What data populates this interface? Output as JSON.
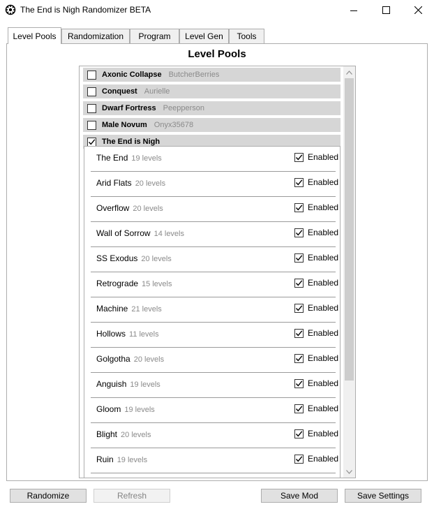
{
  "window": {
    "title": "The End is Nigh Randomizer BETA",
    "icon": "cog-wheel-icon"
  },
  "tabs": [
    {
      "label": "Level Pools",
      "active": true
    },
    {
      "label": "Randomization",
      "active": false
    },
    {
      "label": "Program",
      "active": false
    },
    {
      "label": "Level Gen",
      "active": false
    },
    {
      "label": "Tools",
      "active": false
    }
  ],
  "panel": {
    "heading": "Level Pools"
  },
  "pools": [
    {
      "name": "Axonic Collapse",
      "author": "ButcherBerries",
      "checked": false
    },
    {
      "name": "Conquest",
      "author": "Aurielle",
      "checked": false
    },
    {
      "name": "Dwarf Fortress",
      "author": "Peepperson",
      "checked": false
    },
    {
      "name": "Male Novum",
      "author": "Onyx35678",
      "checked": false
    },
    {
      "name": "The End is Nigh",
      "author": "",
      "checked": true
    }
  ],
  "levels": [
    {
      "name": "The End",
      "count": "19 levels",
      "enabled_label": "Enabled",
      "enabled": true
    },
    {
      "name": "Arid Flats",
      "count": "20 levels",
      "enabled_label": "Enabled",
      "enabled": true
    },
    {
      "name": "Overflow",
      "count": "20 levels",
      "enabled_label": "Enabled",
      "enabled": true
    },
    {
      "name": "Wall of Sorrow",
      "count": "14 levels",
      "enabled_label": "Enabled",
      "enabled": true
    },
    {
      "name": "SS Exodus",
      "count": "20 levels",
      "enabled_label": "Enabled",
      "enabled": true
    },
    {
      "name": "Retrograde",
      "count": "15 levels",
      "enabled_label": "Enabled",
      "enabled": true
    },
    {
      "name": "Machine",
      "count": "21 levels",
      "enabled_label": "Enabled",
      "enabled": true
    },
    {
      "name": "Hollows",
      "count": "11 levels",
      "enabled_label": "Enabled",
      "enabled": true
    },
    {
      "name": "Golgotha",
      "count": "20 levels",
      "enabled_label": "Enabled",
      "enabled": true
    },
    {
      "name": "Anguish",
      "count": "19 levels",
      "enabled_label": "Enabled",
      "enabled": true
    },
    {
      "name": "Gloom",
      "count": "19 levels",
      "enabled_label": "Enabled",
      "enabled": true
    },
    {
      "name": "Blight",
      "count": "20 levels",
      "enabled_label": "Enabled",
      "enabled": true
    },
    {
      "name": "Ruin",
      "count": "19 levels",
      "enabled_label": "Enabled",
      "enabled": true
    }
  ],
  "buttons": {
    "randomize": "Randomize",
    "refresh": "Refresh",
    "save_mod": "Save Mod",
    "save_settings": "Save Settings"
  }
}
